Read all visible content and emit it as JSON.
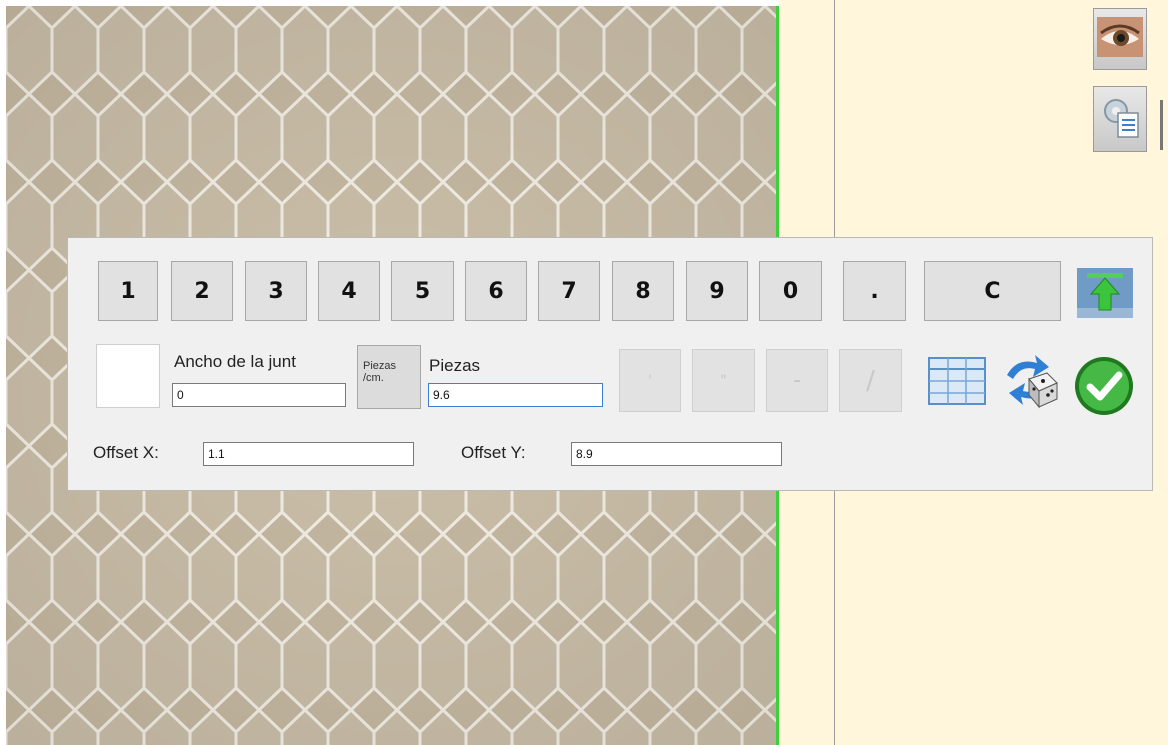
{
  "keypad": {
    "digits": [
      "1",
      "2",
      "3",
      "4",
      "5",
      "6",
      "7",
      "8",
      "9",
      "0"
    ],
    "dot": ".",
    "clear": "C"
  },
  "fraction_keys": [
    "'",
    "\"",
    "-",
    "/"
  ],
  "joint": {
    "label": "Ancho de la junt",
    "value": "0"
  },
  "unit_button": {
    "line1": "Piezas",
    "line2": "/cm."
  },
  "pieces": {
    "label": "Piezas",
    "value": "9.6"
  },
  "offset_x": {
    "label": "Offset X:",
    "value": "1.1"
  },
  "offset_y": {
    "label": "Offset Y:",
    "value": "8.9"
  },
  "icons": {
    "top_right": "upload-arrow-icon",
    "grid": "grid-icon",
    "random": "random-dice-icon",
    "ok": "checkmark-icon",
    "eye": "eye-icon",
    "settings": "settings-list-icon"
  },
  "colors": {
    "texture": "#c9bca6",
    "right_pane": "#fff6dc",
    "edge": "#3ad13a",
    "ok": "#2fa82f"
  }
}
